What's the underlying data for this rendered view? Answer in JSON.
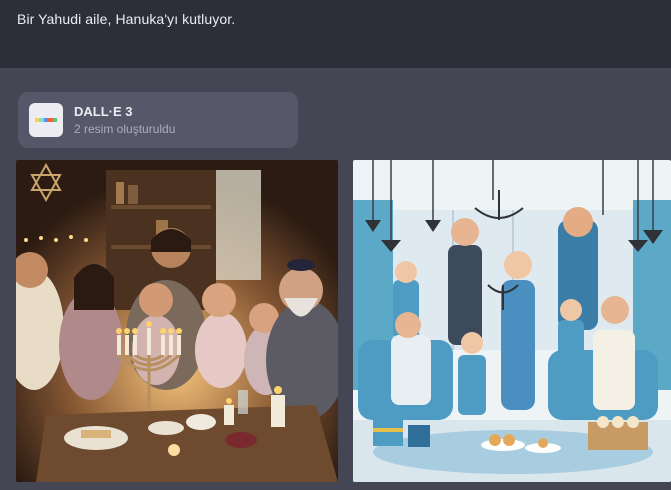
{
  "prompt": {
    "text": "Bir Yahudi aile, Hanuka'yı kutluyor."
  },
  "tool": {
    "name": "DALL·E 3",
    "status": "2 resim oluşturuldu",
    "icon": "dalle-color-stripe-icon",
    "stripe_colors": [
      "#f5d547",
      "#7be0d4",
      "#5a8df0",
      "#f0603f",
      "#50c878"
    ]
  },
  "images": [
    {
      "name": "generated-image-photorealistic",
      "style": "photorealistic"
    },
    {
      "name": "generated-image-illustration",
      "style": "illustration"
    }
  ]
}
